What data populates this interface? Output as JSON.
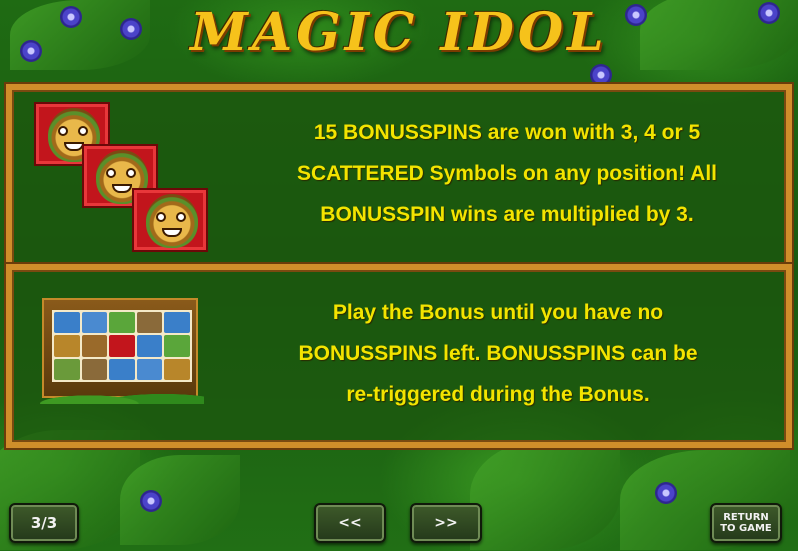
{
  "header": {
    "title": "MAGIC IDOL"
  },
  "panels": [
    {
      "lines": [
        "15 BONUSSPINS are won with 3, 4 or 5",
        "SCATTERED Symbols on any position! All",
        "BONUSSPIN wins are multiplied by 3."
      ],
      "icon": "idol-scatter-symbol-icon"
    },
    {
      "lines": [
        "Play the Bonus until you have no",
        "BONUSSPINS left. BONUSSPINS can be",
        "re-triggered during the Bonus."
      ],
      "icon": "bonus-reels-thumbnail-icon"
    }
  ],
  "footer": {
    "page_indicator": "3/3",
    "prev_label": "<<",
    "next_label": ">>",
    "return_label_line1": "RETURN",
    "return_label_line2": "TO GAME"
  },
  "colors": {
    "text": "#f3e400",
    "frame": "#d08e2a",
    "background": "#1f6b13"
  }
}
